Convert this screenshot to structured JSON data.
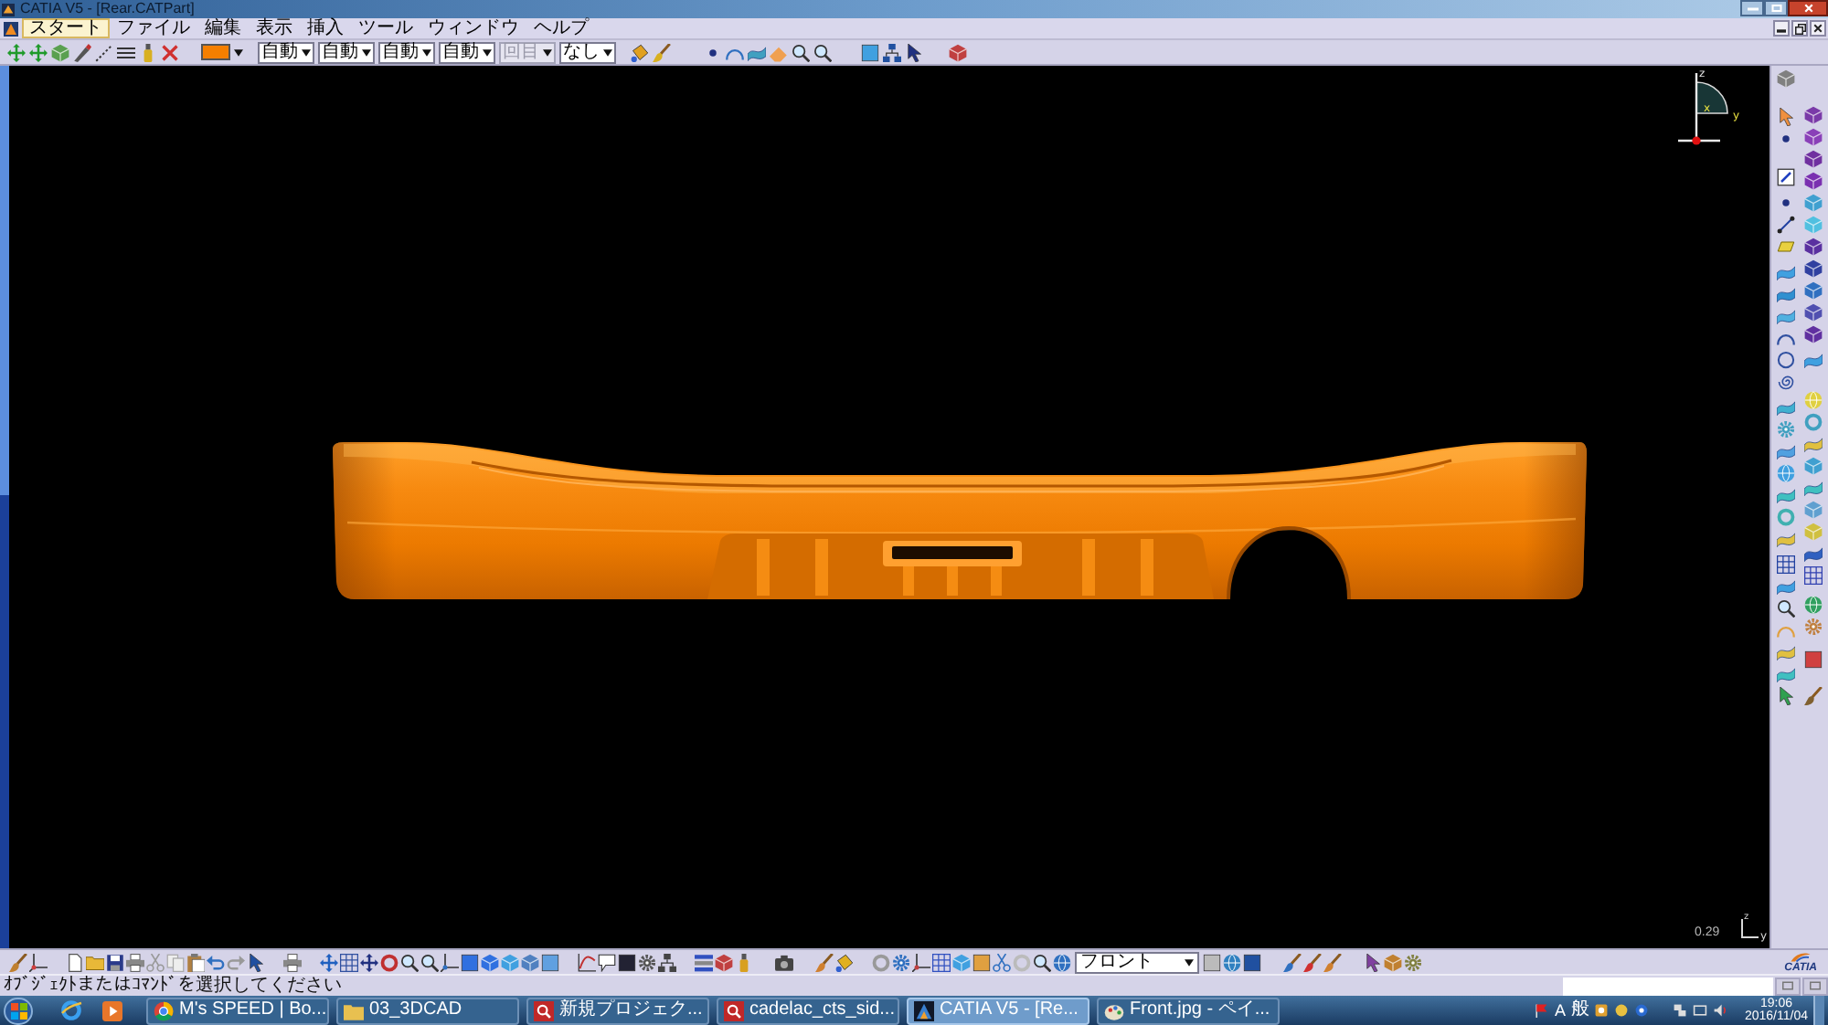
{
  "window": {
    "title": "CATIA V5 - [Rear.CATPart]"
  },
  "menu_bar": {
    "items": [
      {
        "label": "スタート",
        "selected": true
      },
      {
        "label": "ファイル",
        "selected": false
      },
      {
        "label": "編集",
        "selected": false
      },
      {
        "label": "表示",
        "selected": false
      },
      {
        "label": "挿入",
        "selected": false
      },
      {
        "label": "ツール",
        "selected": false
      },
      {
        "label": "ウィンドウ",
        "selected": false
      },
      {
        "label": "ヘルプ",
        "selected": false
      }
    ]
  },
  "graphic_properties": {
    "fill_swatch": {
      "color": "#f57f00"
    },
    "dropdowns": [
      {
        "value": "自動",
        "disabled": false
      },
      {
        "value": "自動",
        "disabled": false
      },
      {
        "value": "自動",
        "disabled": false
      },
      {
        "value": "自動",
        "disabled": false
      },
      {
        "value": "回目",
        "disabled": true
      },
      {
        "value": "なし",
        "disabled": false
      }
    ]
  },
  "viewport": {
    "compass": {
      "vertical_label": "z",
      "horizontal_label": "y",
      "inner_label": "x"
    },
    "scale": "0.29",
    "corner_axis": {
      "vertical_label": "z",
      "horizontal_label": "y"
    }
  },
  "bottom_toolbar": {
    "view_dropdown": "フロント",
    "logo_text": "CATIA"
  },
  "status_bar": {
    "message": "ｵﾌﾞｼﾞｪｸﾄまたはｺﾏﾝﾄﾞを選択してください"
  },
  "taskbar": {
    "windows": [
      {
        "label": "M's SPEED | Bo...",
        "selected": false
      },
      {
        "label": "03_3DCAD",
        "selected": false
      },
      {
        "label": "新規プロジェク...",
        "selected": false
      },
      {
        "label": "cadelac_cts_sid...",
        "selected": false
      },
      {
        "label": "CATIA V5 - [Re...",
        "selected": true
      },
      {
        "label": "Front.jpg - ペイ...",
        "selected": false
      }
    ],
    "tray": {
      "input_mode": "A",
      "ime_mode": "般",
      "time": "19:06",
      "date": "2016/11/04"
    }
  }
}
